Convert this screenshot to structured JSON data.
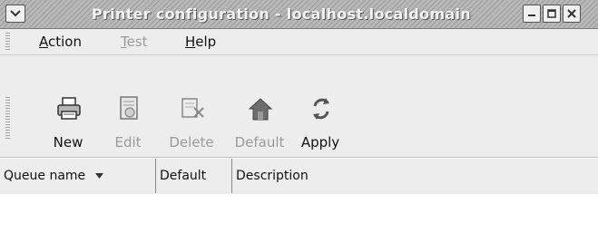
{
  "window": {
    "title": "Printer configuration - localhost.localdomain",
    "menu_icon": "chevron-down-icon",
    "controls": [
      "minimize-icon",
      "maximize-icon",
      "close-icon"
    ]
  },
  "menubar": {
    "items": [
      {
        "label": "Action",
        "mnemonic": "A",
        "rest": "ction",
        "enabled": true
      },
      {
        "label": "Test",
        "mnemonic": "T",
        "rest": "est",
        "enabled": false
      },
      {
        "label": "Help",
        "mnemonic": "H",
        "rest": "elp",
        "enabled": true
      }
    ]
  },
  "toolbar": {
    "buttons": [
      {
        "label": "New",
        "icon": "printer-icon",
        "enabled": true
      },
      {
        "label": "Edit",
        "icon": "edit-icon",
        "enabled": false
      },
      {
        "label": "Delete",
        "icon": "delete-icon",
        "enabled": false
      },
      {
        "label": "Default",
        "icon": "home-icon",
        "enabled": false
      },
      {
        "label": "Apply",
        "icon": "apply-icon",
        "enabled": true
      }
    ]
  },
  "table": {
    "columns": [
      {
        "label": "Queue name",
        "sorted": true
      },
      {
        "label": "Default",
        "sorted": false
      },
      {
        "label": "Description",
        "sorted": false
      }
    ],
    "rows": []
  }
}
